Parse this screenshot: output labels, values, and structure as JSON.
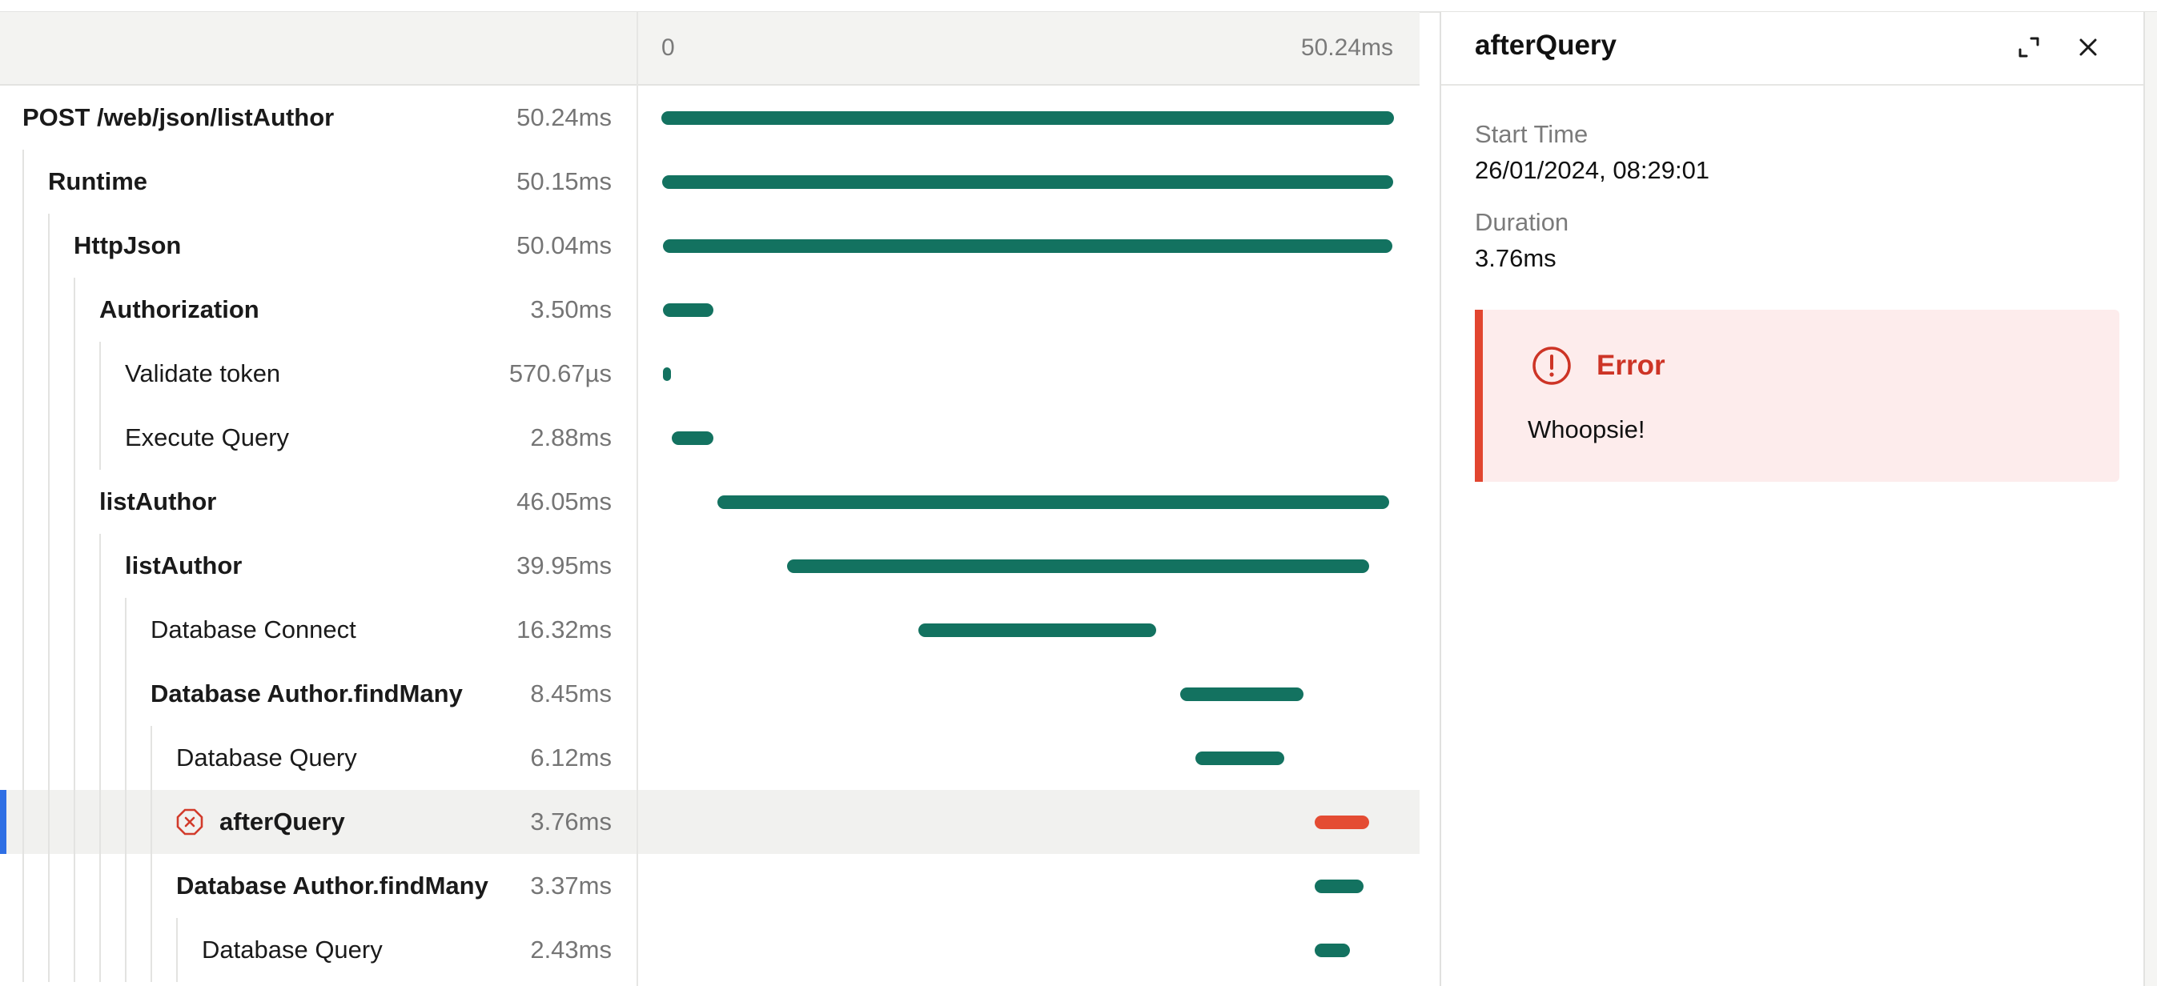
{
  "timeline": {
    "tick_start": "0",
    "tick_end": "50.24ms",
    "total_ms": 50.24
  },
  "spans": [
    {
      "name": "POST /web/json/listAuthor",
      "duration": "50.24ms",
      "depth": 0,
      "bold": true,
      "start_ms": 0.0,
      "dur_ms": 50.24
    },
    {
      "name": "Runtime",
      "duration": "50.15ms",
      "depth": 1,
      "bold": true,
      "start_ms": 0.05,
      "dur_ms": 50.15
    },
    {
      "name": "HttpJson",
      "duration": "50.04ms",
      "depth": 2,
      "bold": true,
      "start_ms": 0.1,
      "dur_ms": 50.04
    },
    {
      "name": "Authorization",
      "duration": "3.50ms",
      "depth": 3,
      "bold": true,
      "start_ms": 0.1,
      "dur_ms": 3.5
    },
    {
      "name": "Validate token",
      "duration": "570.67µs",
      "depth": 4,
      "bold": false,
      "start_ms": 0.1,
      "dur_ms": 0.57
    },
    {
      "name": "Execute Query",
      "duration": "2.88ms",
      "depth": 4,
      "bold": false,
      "start_ms": 0.7,
      "dur_ms": 2.88
    },
    {
      "name": "listAuthor",
      "duration": "46.05ms",
      "depth": 3,
      "bold": true,
      "start_ms": 3.85,
      "dur_ms": 46.05
    },
    {
      "name": "listAuthor",
      "duration": "39.95ms",
      "depth": 4,
      "bold": true,
      "start_ms": 8.6,
      "dur_ms": 39.95
    },
    {
      "name": "Database Connect",
      "duration": "16.32ms",
      "depth": 5,
      "bold": false,
      "start_ms": 17.6,
      "dur_ms": 16.32
    },
    {
      "name": "Database Author.findMany",
      "duration": "8.45ms",
      "depth": 5,
      "bold": true,
      "start_ms": 35.6,
      "dur_ms": 8.45
    },
    {
      "name": "Database Query",
      "duration": "6.12ms",
      "depth": 6,
      "bold": false,
      "start_ms": 36.6,
      "dur_ms": 6.12
    },
    {
      "name": "afterQuery",
      "duration": "3.76ms",
      "depth": 6,
      "bold": true,
      "start_ms": 44.8,
      "dur_ms": 3.76,
      "error": true,
      "selected": true
    },
    {
      "name": "Database Author.findMany",
      "duration": "3.37ms",
      "depth": 6,
      "bold": true,
      "start_ms": 44.8,
      "dur_ms": 3.37
    },
    {
      "name": "Database Query",
      "duration": "2.43ms",
      "depth": 7,
      "bold": false,
      "start_ms": 44.8,
      "dur_ms": 2.43
    }
  ],
  "details": {
    "title": "afterQuery",
    "start_time_label": "Start Time",
    "start_time_value": "26/01/2024, 08:29:01",
    "duration_label": "Duration",
    "duration_value": "3.76ms",
    "error": {
      "title": "Error",
      "message": "Whoopsie!"
    }
  },
  "colors": {
    "bar": "#137260",
    "error_bar": "#e44c33",
    "selected_marker": "#2f6fe4",
    "error_accent": "#e2452f"
  },
  "icons": {
    "expand": "expand-icon",
    "close": "close-icon",
    "span_error": "error-x-icon",
    "error_alert": "alert-circle-icon"
  }
}
